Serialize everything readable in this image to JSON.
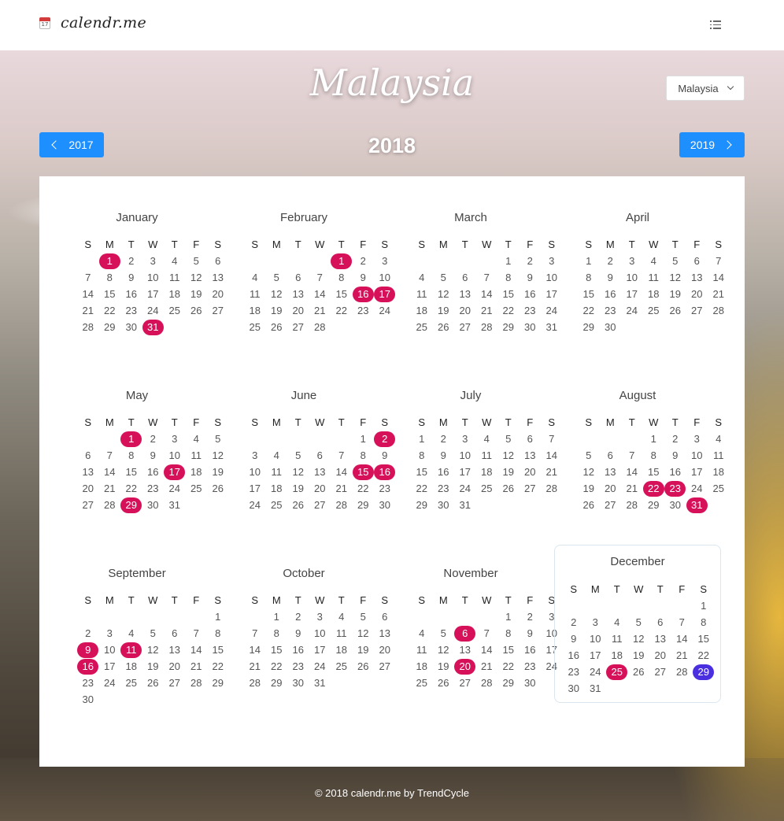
{
  "nav": {
    "logo_text": "calendr.me",
    "logo_icon_day": "17",
    "menu_icon": "list-icon"
  },
  "header": {
    "country": "Malaysia",
    "year": "2018",
    "country_select": "Malaysia",
    "prev_year": "2017",
    "next_year": "2019"
  },
  "weekdays": [
    "S",
    "M",
    "T",
    "W",
    "T",
    "F",
    "S"
  ],
  "colors": {
    "holiday": "#d6115a",
    "today": "#4a2fe0",
    "button": "#1e8fff"
  },
  "months": [
    {
      "name": "January",
      "start": 1,
      "days": 31,
      "holidays": [
        1,
        31
      ]
    },
    {
      "name": "February",
      "start": 4,
      "days": 28,
      "holidays": [
        1,
        16,
        17
      ]
    },
    {
      "name": "March",
      "start": 4,
      "days": 31,
      "holidays": []
    },
    {
      "name": "April",
      "start": 0,
      "days": 30,
      "holidays": []
    },
    {
      "name": "May",
      "start": 2,
      "days": 31,
      "holidays": [
        1,
        17,
        29
      ]
    },
    {
      "name": "June",
      "start": 5,
      "days": 30,
      "holidays": [
        2,
        15,
        16
      ]
    },
    {
      "name": "July",
      "start": 0,
      "days": 31,
      "holidays": []
    },
    {
      "name": "August",
      "start": 3,
      "days": 31,
      "holidays": [
        22,
        23,
        31
      ]
    },
    {
      "name": "September",
      "start": 6,
      "days": 30,
      "holidays": [
        9,
        11,
        16
      ]
    },
    {
      "name": "October",
      "start": 1,
      "days": 31,
      "holidays": []
    },
    {
      "name": "November",
      "start": 4,
      "days": 30,
      "holidays": [
        6,
        20
      ]
    },
    {
      "name": "December",
      "start": 6,
      "days": 31,
      "holidays": [
        25
      ],
      "today": 29,
      "highlighted": true
    }
  ],
  "footer": {
    "text": "© 2018 calendr.me by TrendCycle"
  }
}
